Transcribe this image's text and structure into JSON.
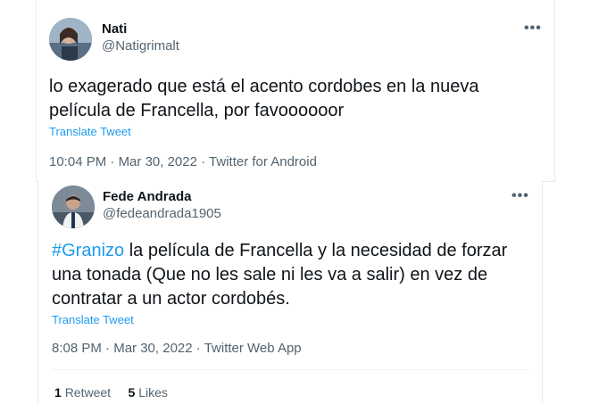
{
  "tweet1": {
    "name": "Nati",
    "handle": "@Natigrimalt",
    "more_icon": "more-horizontal-icon",
    "text": "lo exagerado que está el acento cordobes en la nueva película de Francella, por favoooooor",
    "translate_label": "Translate Tweet",
    "time": "10:04 PM",
    "date": "Mar 30, 2022",
    "source": "Twitter for Android",
    "sep": "·"
  },
  "tweet2": {
    "name": "Fede Andrada",
    "handle": "@fedeandrada1905",
    "more_icon": "more-horizontal-icon",
    "hashtag": "#Granizo",
    "text": " la película de Francella y la necesidad de forzar una tonada (Que no les sale ni les va a salir) en vez de contratar a un actor cordobés.",
    "translate_label": "Translate Tweet",
    "time": "8:08 PM",
    "date": "Mar 30, 2022",
    "source": "Twitter Web App",
    "sep": "·",
    "retweets_count": "1",
    "retweets_label": "Retweet",
    "likes_count": "5",
    "likes_label": "Likes"
  },
  "colors": {
    "link": "#1d9bf0",
    "secondary": "#536471",
    "primary": "#0f1419"
  }
}
